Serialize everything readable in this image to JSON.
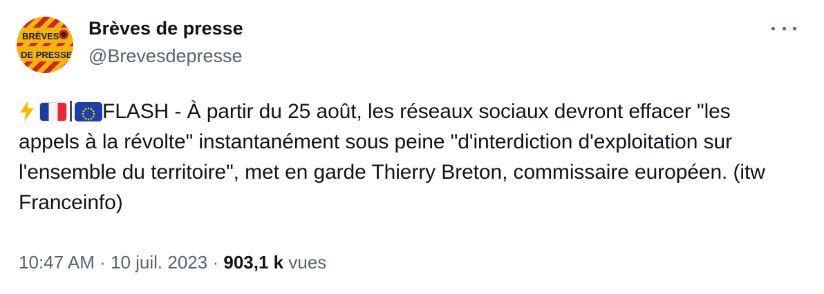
{
  "author": {
    "display_name": "Brèves de presse",
    "handle": "@Brevesdepresse",
    "avatar_text_line1": "BRÈVES",
    "avatar_text_line2": "DE PRESSE"
  },
  "tweet": {
    "text": "FLASH - À partir du 25 août, les réseaux sociaux devront effacer \"les appels à la révolte\" instantanément sous peine \"d'interdiction d'exploitation sur l'ensemble du territoire\", met en garde Thierry Breton, commissaire européen. (itw Franceinfo)",
    "emoji_prefix": [
      "high-voltage",
      "flag-france",
      "flag-european-union"
    ],
    "separator": "|"
  },
  "meta": {
    "time": "10:47 AM",
    "dot1": "·",
    "date": "10 juil. 2023",
    "dot2": "·",
    "views_count": "903,1 k",
    "views_label": "vues"
  },
  "colors": {
    "text_primary": "#0f1419",
    "text_secondary": "#536471",
    "avatar_yellow": "#f2b313",
    "avatar_red": "#c92a20"
  }
}
